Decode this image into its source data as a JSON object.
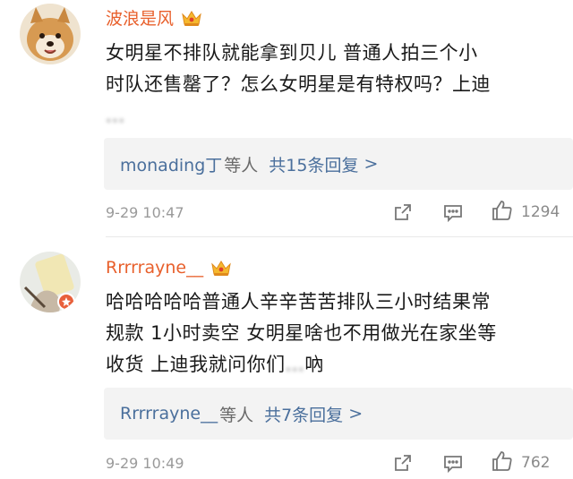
{
  "comments": [
    {
      "username": "波浪是风",
      "body_lines": [
        "女明星不排队就能拿到贝儿 普通人拍三个小",
        "时队还售罄了？怎么女明星是有特权吗？上迪"
      ],
      "blurred_text": "...",
      "reply_user": "monading丁",
      "reply_suffix": "等人",
      "reply_count": "共15条回复",
      "reply_chevron": ">",
      "timestamp": "9-29 10:47",
      "likes": "1294"
    },
    {
      "username": "Rrrrrayne__",
      "body_lines": [
        "哈哈哈哈哈普通人辛辛苦苦排队三小时结果常",
        "规款 1小时卖空 女明星啥也不用做光在家坐等"
      ],
      "last_line_prefix": "收货 上迪我就问你们",
      "blurred_text": "...",
      "last_line_suffix": "吶",
      "reply_user": "Rrrrrayne__",
      "reply_suffix": "等人",
      "reply_count": "共7条回复",
      "reply_chevron": ">",
      "timestamp": "9-29 10:49",
      "likes": "762"
    }
  ],
  "colors": {
    "username": "#e8602c",
    "reply_link": "#4a6f9c",
    "meta": "#9a9a9a",
    "reply_bg": "#f3f3f3"
  },
  "icons": [
    "crown-badge-icon",
    "share-icon",
    "comment-icon",
    "like-icon",
    "verified-badge-icon"
  ]
}
